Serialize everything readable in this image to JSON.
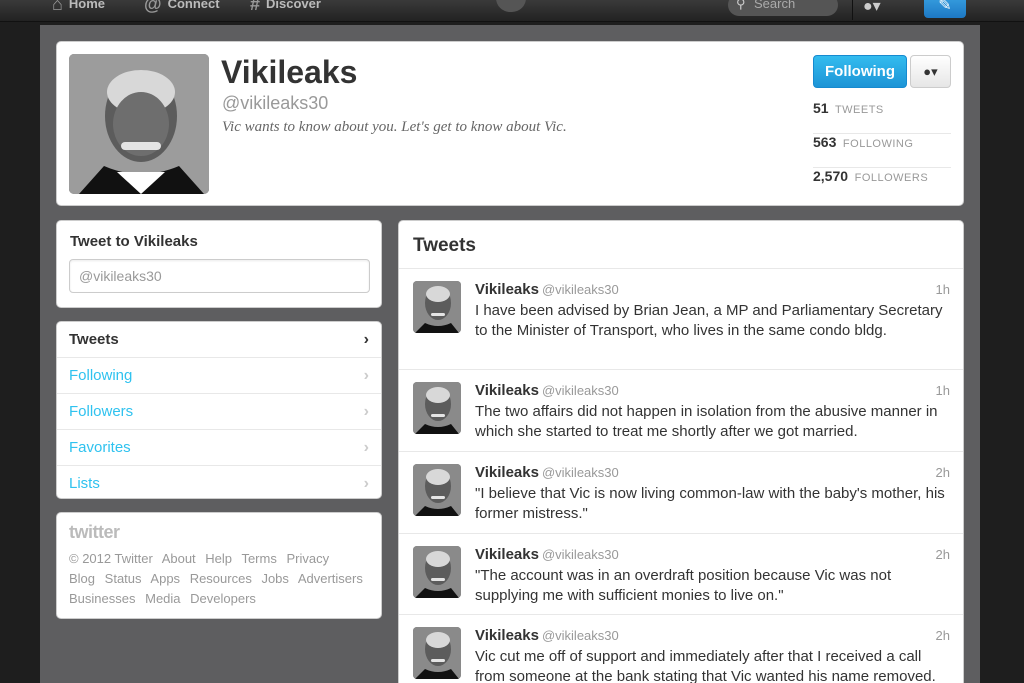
{
  "topnav": {
    "home_label": "Home",
    "connect_label": "Connect",
    "discover_label": "Discover",
    "search_placeholder": "Search"
  },
  "profile": {
    "name": "Vikileaks",
    "handle": "@vikileaks30",
    "bio": "Vic wants to know about you. Let's get to know about Vic.",
    "follow_button": "Following",
    "stats": [
      {
        "count": "51",
        "label": "TWEETS"
      },
      {
        "count": "563",
        "label": "FOLLOWING"
      },
      {
        "count": "2,570",
        "label": "FOLLOWERS"
      }
    ]
  },
  "tweet_to": {
    "title": "Tweet to Vikileaks",
    "input_value": "@vikileaks30"
  },
  "sidenav": {
    "items": [
      {
        "label": "Tweets"
      },
      {
        "label": "Following"
      },
      {
        "label": "Followers"
      },
      {
        "label": "Favorites"
      },
      {
        "label": "Lists"
      }
    ]
  },
  "footer": {
    "logo": "twitter",
    "links": [
      "© 2012 Twitter",
      "About",
      "Help",
      "Terms",
      "Privacy",
      "Blog",
      "Status",
      "Apps",
      "Resources",
      "Jobs",
      "Advertisers",
      "Businesses",
      "Media",
      "Developers"
    ]
  },
  "stream": {
    "title": "Tweets",
    "tweets": [
      {
        "name": "Vikileaks",
        "handle": "@vikileaks30",
        "time": "1h",
        "text": "I have been advised by Brian Jean, a MP and Parliamentary Secretary to the Minister of Transport, who lives in the same condo bldg."
      },
      {
        "name": "Vikileaks",
        "handle": "@vikileaks30",
        "time": "1h",
        "text": "The two affairs did not happen in isolation from the abusive manner in which she started to treat me shortly after we got married."
      },
      {
        "name": "Vikileaks",
        "handle": "@vikileaks30",
        "time": "2h",
        "text": "\"I believe that Vic is now living common-law with the baby's mother, his former mistress.\""
      },
      {
        "name": "Vikileaks",
        "handle": "@vikileaks30",
        "time": "2h",
        "text": "\"The account was in an overdraft position because Vic was not supplying me with sufficient monies to live on.\""
      },
      {
        "name": "Vikileaks",
        "handle": "@vikileaks30",
        "time": "2h",
        "text": "Vic cut me off of support and immediately after that I received a call from someone at the bank stating that Vic wanted his name removed."
      }
    ]
  },
  "colors": {
    "link_blue": "#2fc2ef",
    "follow_button": "#1d94d6",
    "background": "#5e5e60"
  }
}
